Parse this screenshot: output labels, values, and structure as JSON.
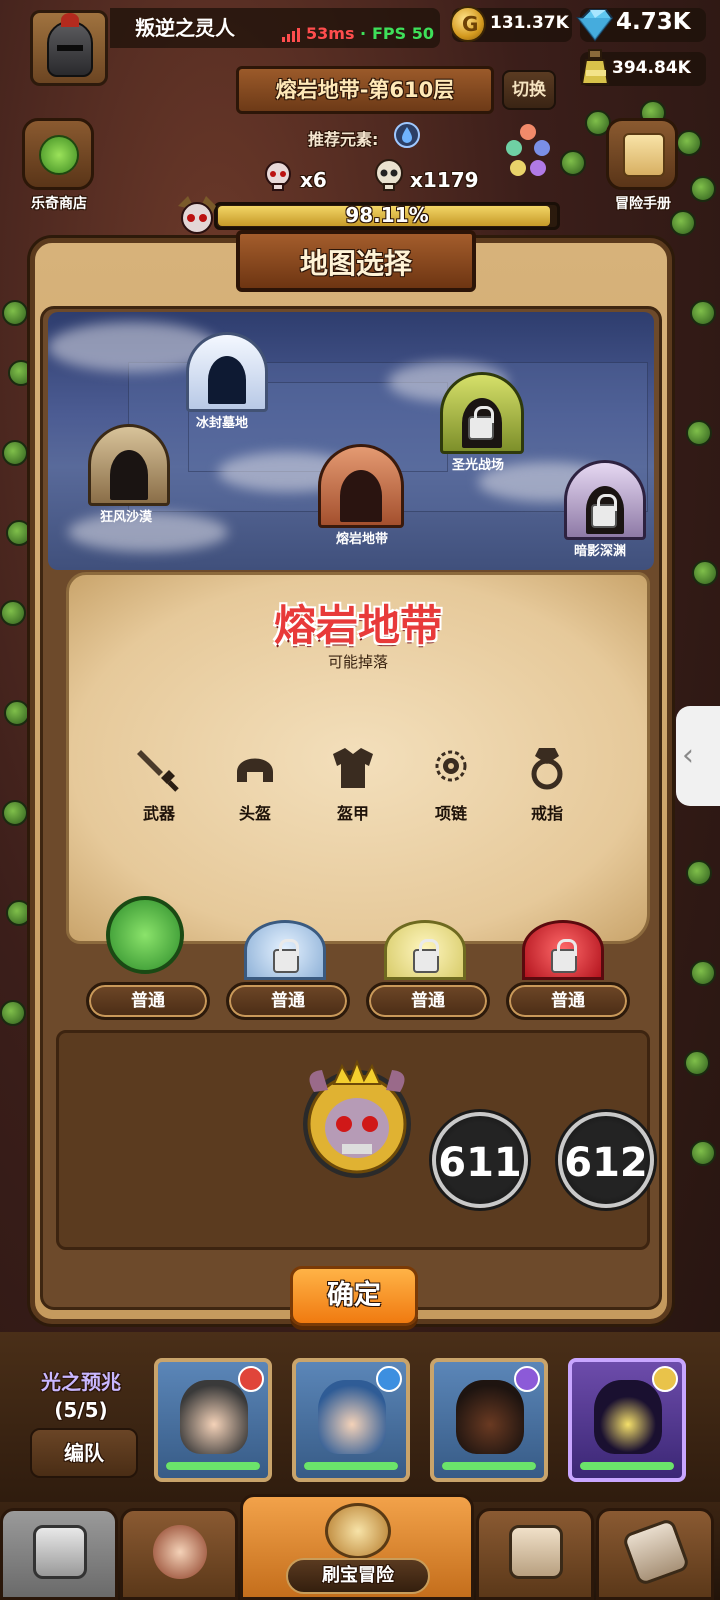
{
  "player": {
    "name": "叛逆之灵人"
  },
  "network": {
    "ping": "53ms",
    "separator": "·",
    "fps": "FPS 50"
  },
  "resources": {
    "gold": "131.37K",
    "gems": "4.73K",
    "potion": "394.84K"
  },
  "stage": {
    "title": "熔岩地带-第610层",
    "switch_label": "切换"
  },
  "recommend": {
    "label": "推荐元素:",
    "element_icon": "water-drop-icon"
  },
  "kills": {
    "elite": "x6",
    "normal": "x1179"
  },
  "progress": {
    "percent_text": "98.11%",
    "fraction": 0.9811
  },
  "side_buttons": {
    "shop": "乐奇商店",
    "handbook": "冒险手册"
  },
  "modal": {
    "title": "地图选择",
    "maps": [
      {
        "name": "冰封墓地",
        "locked": false
      },
      {
        "name": "狂风沙漠",
        "locked": false
      },
      {
        "name": "熔岩地带",
        "locked": false
      },
      {
        "name": "圣光战场",
        "locked": true
      },
      {
        "name": "暗影深渊",
        "locked": true
      }
    ],
    "selected_zone": "熔岩地带",
    "drops_label": "可能掉落",
    "drops": [
      {
        "label": "武器",
        "icon": "sword-icon"
      },
      {
        "label": "头盔",
        "icon": "helmet-icon"
      },
      {
        "label": "盔甲",
        "icon": "armor-icon"
      },
      {
        "label": "项链",
        "icon": "necklace-icon"
      },
      {
        "label": "戒指",
        "icon": "ring-icon"
      }
    ],
    "difficulties": [
      {
        "label": "普通",
        "color": "#3fbf3f",
        "locked": false
      },
      {
        "label": "普通",
        "color": "#9fc3e6",
        "locked": true
      },
      {
        "label": "普通",
        "color": "#e6dc8a",
        "locked": true
      },
      {
        "label": "普通",
        "color": "#d8242e",
        "locked": true
      }
    ],
    "levels": [
      "611",
      "612"
    ],
    "confirm_label": "确定"
  },
  "team": {
    "name": "光之预兆",
    "count": "(5/5)",
    "formation_label": "编队"
  },
  "heroes": [
    {
      "element": "fire-icon",
      "color": "#e0453a"
    },
    {
      "element": "water-drop-icon",
      "color": "#3d8fe0"
    },
    {
      "element": "moon-icon",
      "color": "#8c5ad8"
    },
    {
      "element": "sun-icon",
      "color": "#e9c34a"
    }
  ],
  "nav": {
    "adventure_label": "刷宝冒险"
  },
  "colors": {
    "accent_orange": "#f07a10",
    "title_red": "#e83a3a",
    "fps_green": "#3ee05a",
    "ping_red": "#ff4d4d"
  }
}
